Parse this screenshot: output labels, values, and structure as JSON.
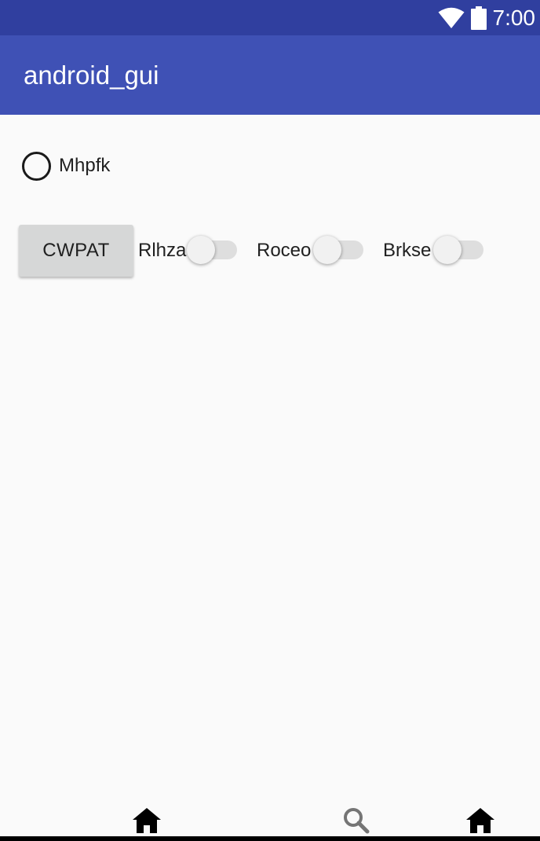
{
  "status_bar": {
    "time": "7:00",
    "icons": [
      "wifi-icon",
      "battery-icon"
    ]
  },
  "app_bar": {
    "title": "android_gui"
  },
  "radio": {
    "label": "Mhpfk",
    "checked": false
  },
  "button": {
    "label": "CWPAT"
  },
  "switches": [
    {
      "label": "Rlhza",
      "checked": false
    },
    {
      "label": "Roceo",
      "checked": false
    },
    {
      "label": "Brkse",
      "checked": false
    }
  ],
  "nav_bar": {
    "icons": [
      "home-icon",
      "search-icon",
      "home-icon"
    ]
  },
  "colors": {
    "status_bar": "#303f9f",
    "app_bar": "#3f51b5",
    "background": "#fafafa",
    "button": "#d6d7d7"
  }
}
